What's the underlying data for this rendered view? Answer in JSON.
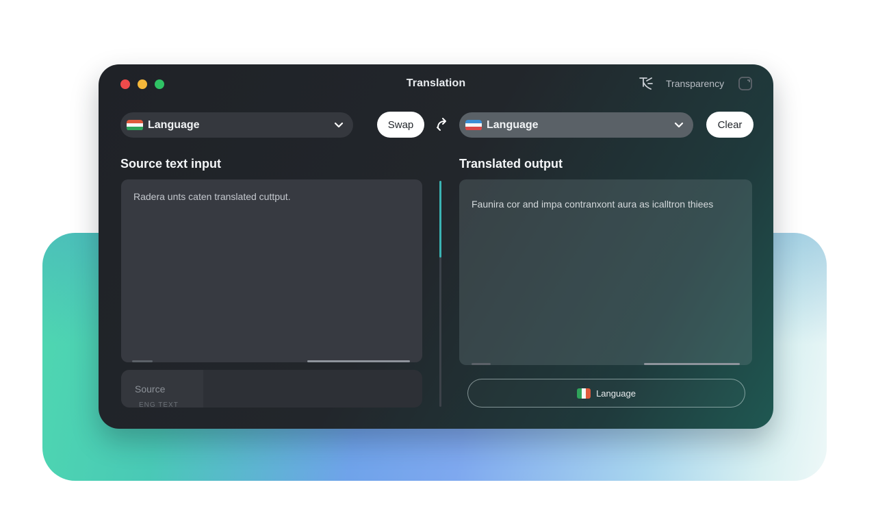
{
  "window": {
    "title": "Translation",
    "toolbar_label": "Transparency"
  },
  "source": {
    "language_label": "Language",
    "section_title": "Source text input",
    "text": "Radera unts caten translated cuttput.",
    "footer_label": "Source",
    "footer_sub": "ENG  TEXT"
  },
  "controls": {
    "swap_label": "Swap",
    "clear_label": "Clear"
  },
  "target": {
    "language_label": "Language",
    "section_title": "Translated output",
    "text": "Faunira cor and impa contranxont aura as icalltron thiees",
    "output_language_label": "Language"
  },
  "icons": {
    "close": "close-dot",
    "minimize": "minimize-dot",
    "maximize": "maximize-dot",
    "translate": "translate-icon",
    "window_square": "square-icon",
    "swap": "swap-arrow-icon",
    "chevron": "chevron-down-icon"
  },
  "colors": {
    "accent_teal": "#3bb3b3",
    "window_bg": "#22262b"
  }
}
